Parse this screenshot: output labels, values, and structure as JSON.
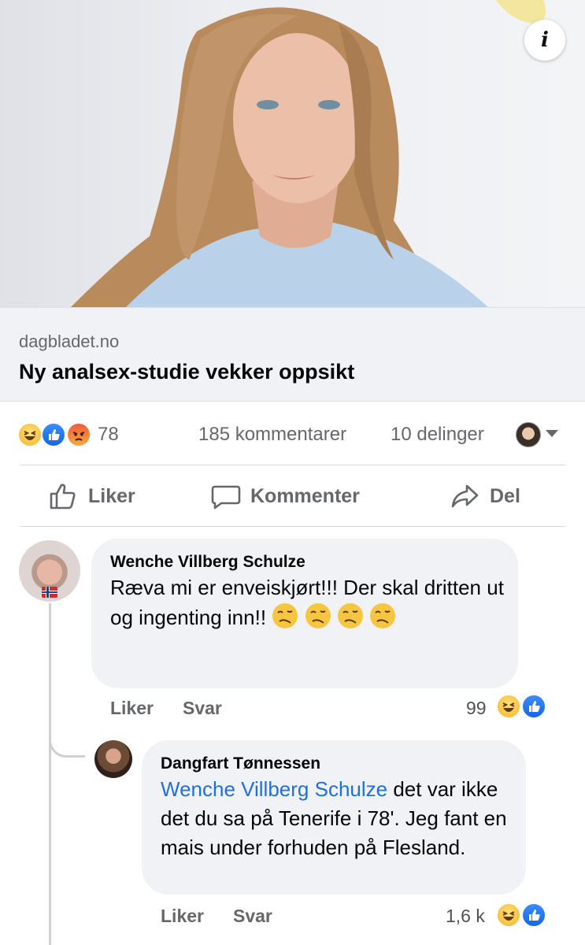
{
  "link_preview": {
    "domain": "dagbladet.no",
    "title": "Ny analsex-studie vekker oppsikt",
    "info_icon": "info-icon"
  },
  "reactions_summary": {
    "icons": [
      "haha-icon",
      "like-icon",
      "angry-icon"
    ],
    "count": "78",
    "comments": "185 kommentarer",
    "shares": "10 delinger"
  },
  "actions": {
    "like_label": "Liker",
    "comment_label": "Kommenter",
    "share_label": "Del"
  },
  "comments": [
    {
      "author": "Wenche Villberg Schulze",
      "text": "Ræva mi er enveiskjørt!!! Der skal dritten ut og ingenting inn!!",
      "emoji": "woozy-face",
      "like_label": "Liker",
      "reply_label": "Svar",
      "reaction_count": "99",
      "reaction_icons": [
        "haha-icon",
        "like-icon"
      ]
    },
    {
      "author": "Dangfart Tønnessen",
      "mention": "Wenche Villberg Schulze",
      "text": " det var ikke det du sa på Tenerife i 78'. Jeg fant en mais under forhuden på Flesland.",
      "like_label": "Liker",
      "reply_label": "Svar",
      "reaction_count": "1,6 k",
      "reaction_icons": [
        "haha-icon",
        "like-icon"
      ]
    }
  ],
  "colors": {
    "link_blue": "#216fdb",
    "muted_text": "#65676b",
    "bubble_bg": "#f0f2f5",
    "like_blue": "#1467e6"
  }
}
